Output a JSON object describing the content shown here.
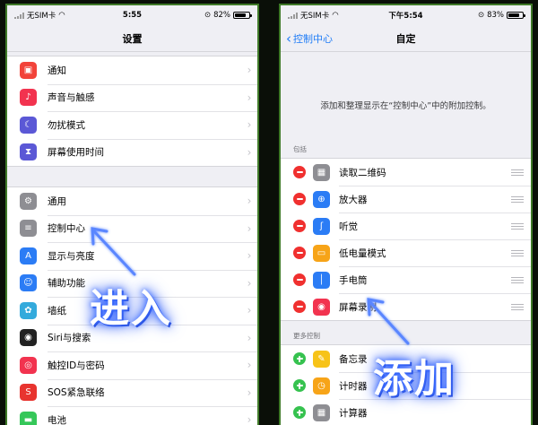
{
  "left": {
    "status": {
      "carrier": "无SIM卡",
      "time": "5:55",
      "battery": "82%",
      "battery_level": 0.82
    },
    "title": "设置",
    "group1": [
      {
        "label": "通知",
        "icon": "notification-icon",
        "color": "#f2433a"
      },
      {
        "label": "声音与触感",
        "icon": "speaker-icon",
        "color": "#f2334f"
      },
      {
        "label": "勿扰模式",
        "icon": "moon-icon",
        "color": "#5b58d6"
      },
      {
        "label": "屏幕使用时间",
        "icon": "hourglass-icon",
        "color": "#5b58d6"
      }
    ],
    "group2": [
      {
        "label": "通用",
        "icon": "gear-icon",
        "color": "#8e8e93"
      },
      {
        "label": "控制中心",
        "icon": "control-center-icon",
        "color": "#8e8e93"
      },
      {
        "label": "显示与亮度",
        "icon": "display-aa-icon",
        "color": "#2b7cf5"
      },
      {
        "label": "辅助功能",
        "icon": "accessibility-icon",
        "color": "#2b7cf5"
      },
      {
        "label": "墙纸",
        "icon": "wallpaper-flower-icon",
        "color": "#33aadc"
      },
      {
        "label": "Siri与搜索",
        "icon": "siri-icon",
        "color": "#222222"
      },
      {
        "label": "触控ID与密码",
        "icon": "fingerprint-icon",
        "color": "#f2334f"
      },
      {
        "label": "SOS紧急联络",
        "icon": "sos-icon",
        "color": "#e8342f"
      },
      {
        "label": "电池",
        "icon": "battery-icon",
        "color": "#35c759"
      }
    ]
  },
  "right": {
    "status": {
      "carrier": "无SIM卡",
      "time": "下午5:54",
      "battery": "83%",
      "battery_level": 0.83
    },
    "back_label": "控制中心",
    "title": "自定",
    "description": "添加和整理显示在“控制中心”中的附加控制。",
    "included_header": "包括",
    "included": [
      {
        "label": "读取二维码",
        "icon": "qr-code-icon",
        "color": "#8e8e93"
      },
      {
        "label": "放大器",
        "icon": "magnifier-icon",
        "color": "#2b7cf5"
      },
      {
        "label": "听觉",
        "icon": "ear-icon",
        "color": "#2b7cf5"
      },
      {
        "label": "低电量模式",
        "icon": "low-power-battery-icon",
        "color": "#f7a418"
      },
      {
        "label": "手电筒",
        "icon": "flashlight-icon",
        "color": "#2b7cf5"
      },
      {
        "label": "屏幕录制",
        "icon": "screen-record-icon",
        "color": "#f2334f"
      }
    ],
    "more_header": "更多控制",
    "more": [
      {
        "label": "备忘录",
        "icon": "notes-icon",
        "color": "#f7c318"
      },
      {
        "label": "计时器",
        "icon": "timer-icon",
        "color": "#f7a418"
      },
      {
        "label": "计算器",
        "icon": "calculator-icon",
        "color": "#8e8e93"
      }
    ]
  },
  "annotations": {
    "enter": "进入",
    "add": "添加",
    "arrow_color": "#5a86ff"
  }
}
